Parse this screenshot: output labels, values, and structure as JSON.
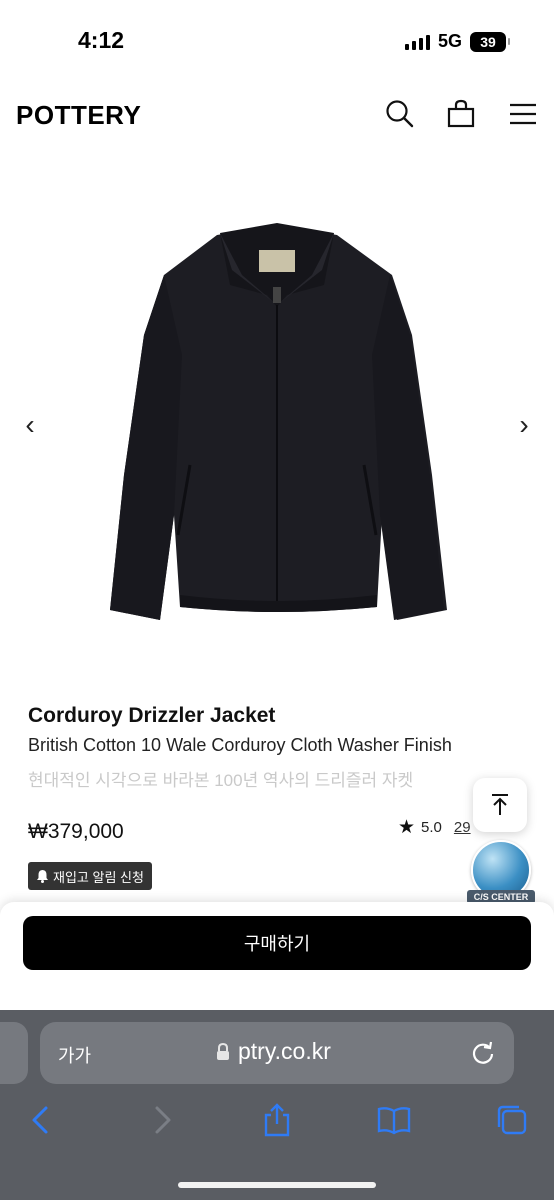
{
  "status": {
    "time": "4:12",
    "network": "5G",
    "battery": "39"
  },
  "header": {
    "logo": "POTTERY"
  },
  "product": {
    "title": "Corduroy Drizzler Jacket",
    "subtitle": "British Cotton 10 Wale Corduroy Cloth Washer Finish",
    "description": "현대적인 시각으로 바라본 100년 역사의 드리즐러 자켓",
    "price": "₩379,000",
    "rating": "5.0",
    "reviews": "29",
    "restock_label": "재입고 알림 신청"
  },
  "gallery": {
    "prev_label": "‹",
    "next_label": "›"
  },
  "cs_center": {
    "label": "C/S CENTER"
  },
  "buy": {
    "label": "구매하기"
  },
  "browser": {
    "aa_label": "가가",
    "url": "ptry.co.kr"
  },
  "colors": {
    "accent": "#000000",
    "safari_blue": "#2f7bf5",
    "jacket": "#1c1c22"
  },
  "icons": [
    "search-icon",
    "cart-icon",
    "menu-icon",
    "star-icon",
    "bell-icon",
    "scroll-top-icon",
    "lock-icon",
    "reload-icon",
    "back-icon",
    "forward-icon",
    "share-icon",
    "bookmarks-icon",
    "tabs-icon"
  ]
}
